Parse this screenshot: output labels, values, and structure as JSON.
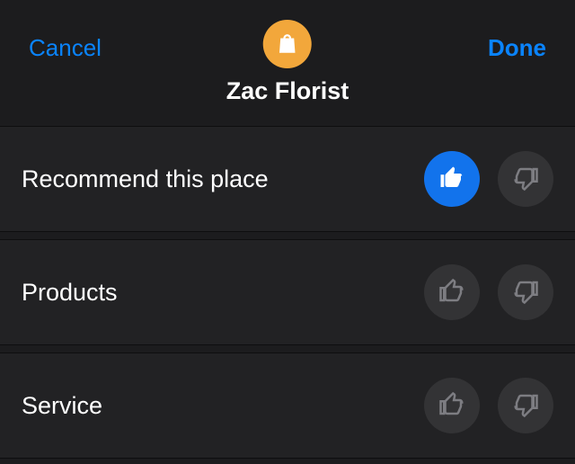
{
  "header": {
    "cancel_label": "Cancel",
    "done_label": "Done",
    "place_name": "Zac Florist",
    "place_icon": "shopping-bag-icon"
  },
  "rows": [
    {
      "id": "recommend",
      "label": "Recommend this place",
      "up_selected": true,
      "down_selected": false
    },
    {
      "id": "products",
      "label": "Products",
      "up_selected": false,
      "down_selected": false
    },
    {
      "id": "service",
      "label": "Service",
      "up_selected": false,
      "down_selected": false
    }
  ],
  "colors": {
    "accent": "#0a84ff",
    "selected": "#1273ec",
    "icon_bg": "#f2a73b",
    "bg": "#1c1c1e",
    "row_bg": "#222224"
  }
}
